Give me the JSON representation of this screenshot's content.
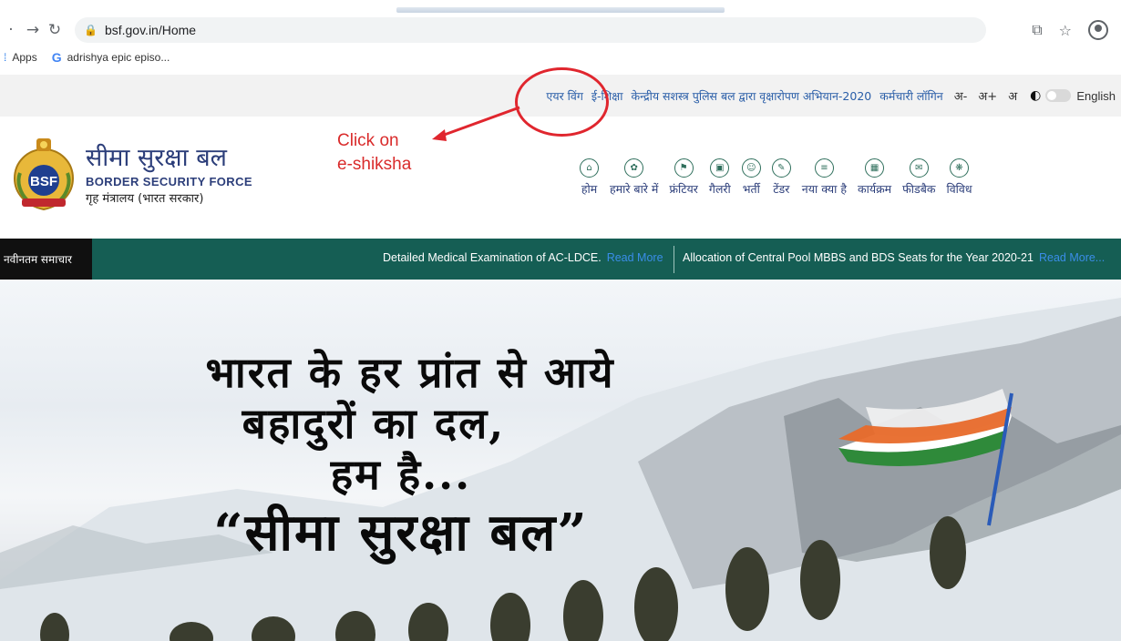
{
  "browser": {
    "url": "bsf.gov.in/Home",
    "bookmarks": {
      "apps_label": "Apps",
      "bookmark_1": "adrishya epic episo..."
    }
  },
  "utility_bar": {
    "links": [
      "एयर विंग",
      "ई-शिक्षा",
      "केन्द्रीय सशस्त्र पुलिस बल द्वारा वृक्षारोपण अभियान-2020",
      "कर्मचारी लॉगिन"
    ],
    "font_small": "अ-",
    "font_large": "अ+",
    "font_normal": "अ",
    "language": "English"
  },
  "annotation": {
    "line1": "Click on",
    "line2": "e-shiksha",
    "color": "#e0262e"
  },
  "header": {
    "logo_text": "BSF",
    "title_hindi": "सीमा सुरक्षा बल",
    "title_english": "BORDER SECURITY FORCE",
    "ministry": "गृह मंत्रालय (भारत सरकार)"
  },
  "main_nav": [
    {
      "label": "होम",
      "icon": "home-icon"
    },
    {
      "label": "हमारे बारे में",
      "icon": "about-icon"
    },
    {
      "label": "फ्रंटियर",
      "icon": "frontier-icon"
    },
    {
      "label": "गैलरी",
      "icon": "gallery-icon"
    },
    {
      "label": "भर्ती",
      "icon": "recruitment-icon"
    },
    {
      "label": "टेंडर",
      "icon": "tender-icon"
    },
    {
      "label": "नया क्या है",
      "icon": "whats-new-icon"
    },
    {
      "label": "कार्यक्रम",
      "icon": "events-icon"
    },
    {
      "label": "फीडबैक",
      "icon": "feedback-icon"
    },
    {
      "label": "विविध",
      "icon": "misc-icon"
    }
  ],
  "news": {
    "label": "नवीनतम समाचार",
    "items": [
      {
        "text": "Detailed Medical Examination of AC-LDCE.",
        "link": "Read More"
      },
      {
        "text": "Allocation of Central Pool MBBS and BDS Seats for the Year 2020-21",
        "link": "Read More..."
      }
    ]
  },
  "hero": {
    "line1": "भारत के हर प्रांत से आये",
    "line2": "बहादुरों का दल,",
    "line3": "हम है...",
    "line4": "“सीमा सुरक्षा बल”"
  },
  "colors": {
    "news_bar": "#155e54",
    "nav_text": "#2c3e7a",
    "link": "#2a5ea8"
  }
}
